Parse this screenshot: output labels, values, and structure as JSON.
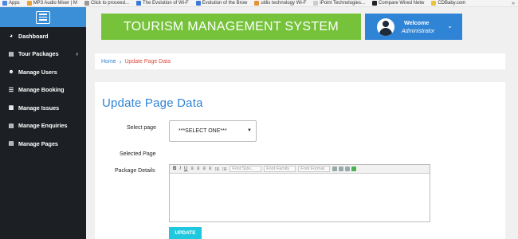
{
  "bookmarks": [
    {
      "label": "Apps",
      "color": "#4a86e8"
    },
    {
      "label": "MP3 Audio Mixer | M",
      "color": "#e8a23a"
    },
    {
      "label": "Click to proceed...",
      "color": "#999999"
    },
    {
      "label": "The Evolution of Wi-F",
      "color": "#3c78d8"
    },
    {
      "label": "Evolution of the Brow",
      "color": "#3c78d8"
    },
    {
      "label": "utilis technology Wi-F",
      "color": "#e69138"
    },
    {
      "label": "iPoint Technologies...",
      "color": "#cccccc"
    },
    {
      "label": "Compare Wired Netw",
      "color": "#222222"
    },
    {
      "label": "CDBaby.com",
      "color": "#e8c33a"
    }
  ],
  "bookmarks_more": "»",
  "sidebar": {
    "items": [
      {
        "label": "Dashboard",
        "icon": "dashboard-icon",
        "glyph": "◕"
      },
      {
        "label": "Tour Packages",
        "icon": "files-icon",
        "glyph": "▤",
        "chevron": "›"
      },
      {
        "label": "Manage Users",
        "icon": "users-icon",
        "glyph": "☻"
      },
      {
        "label": "Manage Booking",
        "icon": "booking-icon",
        "glyph": "☰"
      },
      {
        "label": "Manage Issues",
        "icon": "issues-icon",
        "glyph": "▦"
      },
      {
        "label": "Manage Enquiries",
        "icon": "enquiries-icon",
        "glyph": "▤"
      },
      {
        "label": "Manage Pages",
        "icon": "pages-icon",
        "glyph": "▤"
      }
    ]
  },
  "header": {
    "title": "TOURISM MANAGEMENT SYSTEM",
    "welcome": "Welcome",
    "role": "Administrator",
    "caret": "⌄"
  },
  "breadcrumb": {
    "home": "Home",
    "separator": "›",
    "current": "Update Page Data"
  },
  "form": {
    "title": "Update Page Data",
    "select_label": "Select page",
    "select_value": "***SELECT ONE***",
    "selected_label": "Selected Page",
    "details_label": "Package Details",
    "toolbar": {
      "bold": "B",
      "italic": "I",
      "underline": "U",
      "font_size": "Font Size...",
      "font_family": "Font Family",
      "font_format": "Font Format"
    },
    "update_label": "UPDATE"
  },
  "colors": {
    "accent_blue": "#2f84d6",
    "title_green": "#76c33b",
    "sidebar_dark": "#1c2024",
    "button_cyan": "#1fc8de",
    "breadcrumb_red": "#e04a3f"
  }
}
